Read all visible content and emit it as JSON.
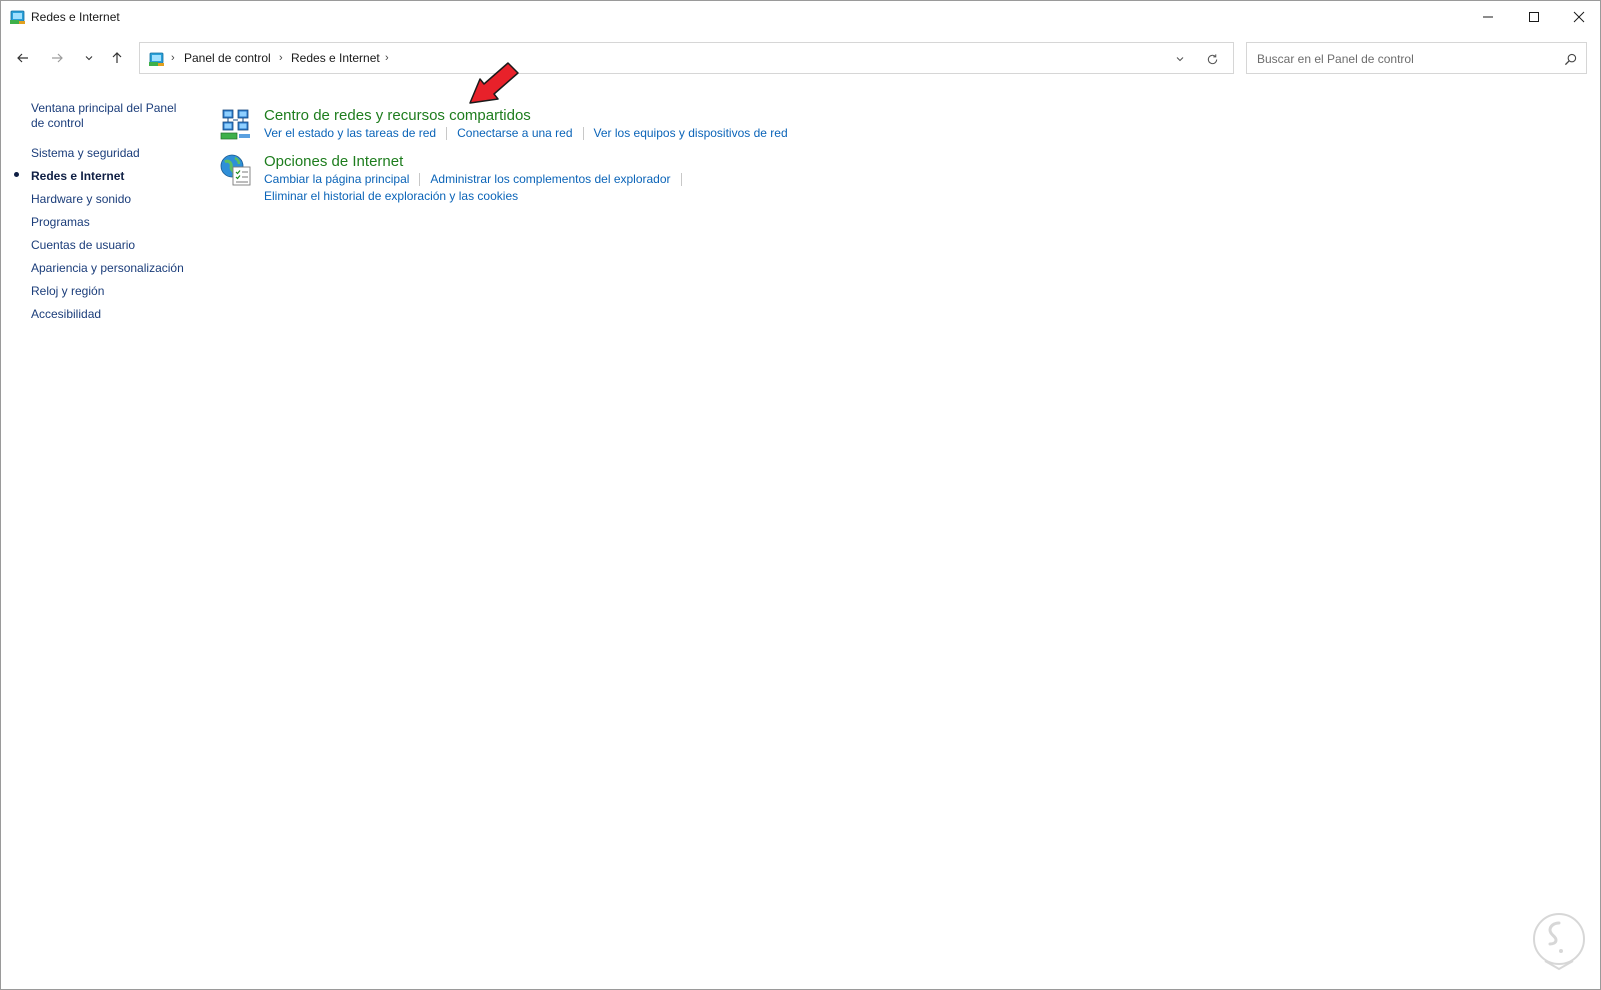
{
  "window": {
    "title": "Redes e Internet",
    "minimize_icon": "minimize-icon",
    "maximize_icon": "maximize-icon",
    "close_icon": "close-icon"
  },
  "nav": {
    "back_icon": "arrow-left-icon",
    "forward_icon": "arrow-right-icon",
    "recent_icon": "chevron-down-icon",
    "up_icon": "arrow-up-icon"
  },
  "address": {
    "breadcrumbs": [
      "Panel de control",
      "Redes e Internet"
    ],
    "separator": "›",
    "dropdown_icon": "chevron-down-icon",
    "refresh_icon": "refresh-icon"
  },
  "search": {
    "placeholder": "Buscar en el Panel de control",
    "value": "",
    "icon": "search-icon"
  },
  "sidebar": {
    "items": [
      {
        "label": "Ventana principal del Panel de control",
        "active": false
      },
      {
        "label": "Sistema y seguridad",
        "active": false
      },
      {
        "label": "Redes e Internet",
        "active": true
      },
      {
        "label": "Hardware y sonido",
        "active": false
      },
      {
        "label": "Programas",
        "active": false
      },
      {
        "label": "Cuentas de usuario",
        "active": false
      },
      {
        "label": "Apariencia y personalización",
        "active": false
      },
      {
        "label": "Reloj y región",
        "active": false
      },
      {
        "label": "Accesibilidad",
        "active": false
      }
    ]
  },
  "categories": [
    {
      "title": "Centro de redes y recursos compartidos",
      "icon": "network-center-icon",
      "tasks": [
        "Ver el estado y las tareas de red",
        "Conectarse a una red",
        "Ver los equipos y dispositivos de red"
      ]
    },
    {
      "title": "Opciones de Internet",
      "icon": "internet-options-icon",
      "tasks": [
        "Cambiar la página principal",
        "Administrar los complementos del explorador",
        "Eliminar el historial de exploración y las cookies"
      ]
    }
  ],
  "colors": {
    "category_title": "#1e7d1e",
    "task_link": "#0b64b8",
    "sidebar_link": "#1b3d7a",
    "annotation_arrow": "#e8212a"
  }
}
